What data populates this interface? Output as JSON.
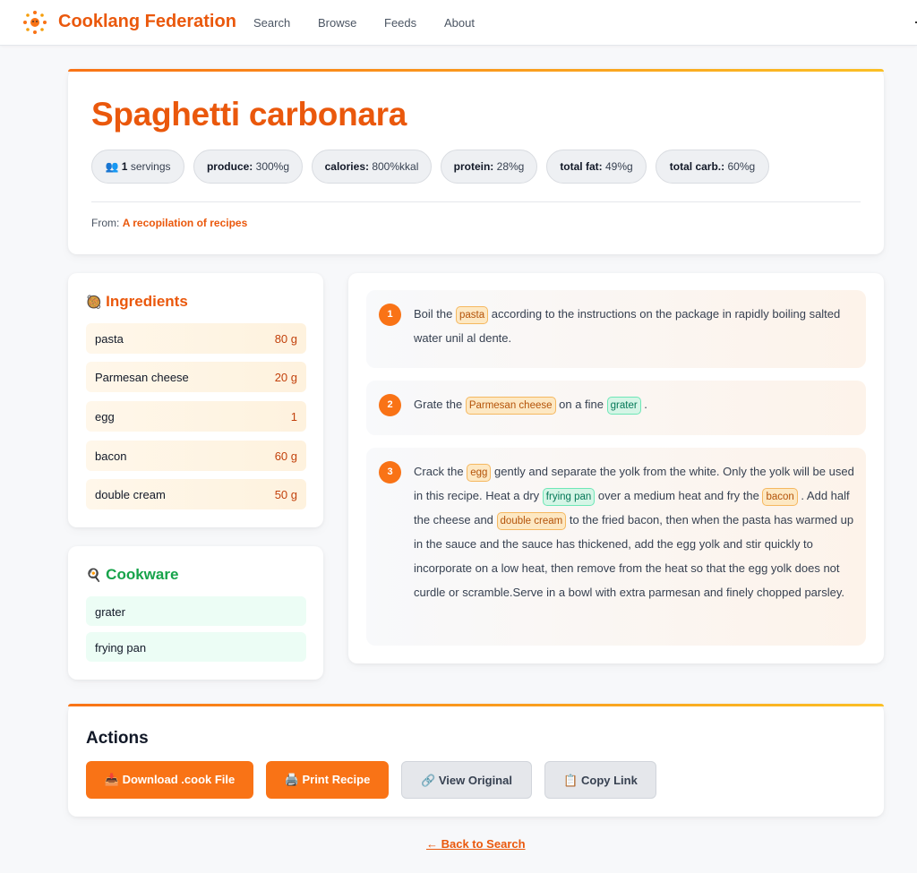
{
  "nav": {
    "brand": "Cooklang Federation",
    "links": [
      "Search",
      "Browse",
      "Feeds",
      "About"
    ]
  },
  "recipe": {
    "title": "Spaghetti carbonara",
    "servings_icon": "👥",
    "servings_count": "1",
    "servings_label": "servings",
    "nutrition": [
      {
        "label": "produce:",
        "value": "300%g"
      },
      {
        "label": "calories:",
        "value": "800%kkal"
      },
      {
        "label": "protein:",
        "value": "28%g"
      },
      {
        "label": "total fat:",
        "value": "49%g"
      },
      {
        "label": "total carb.:",
        "value": "60%g"
      }
    ],
    "from_label": "From:",
    "from_link": "A recopilation of recipes"
  },
  "ingredients": {
    "icon": "🥘",
    "heading": "Ingredients",
    "items": [
      {
        "name": "pasta",
        "qty": "80 g"
      },
      {
        "name": "Parmesan cheese",
        "qty": "20 g"
      },
      {
        "name": "egg",
        "qty": "1"
      },
      {
        "name": "bacon",
        "qty": "60 g"
      },
      {
        "name": "double cream",
        "qty": "50 g"
      }
    ]
  },
  "cookware": {
    "icon": "🍳",
    "heading": "Cookware",
    "items": [
      "grater",
      "frying pan"
    ]
  },
  "steps": [
    {
      "num": "1",
      "parts": [
        {
          "t": "Boil the "
        },
        {
          "ing": "pasta"
        },
        {
          "t": " according to the instructions on the package in rapidly boiling salted water unil al dente."
        }
      ]
    },
    {
      "num": "2",
      "parts": [
        {
          "t": "Grate the "
        },
        {
          "ing": "Parmesan cheese"
        },
        {
          "t": " on a fine "
        },
        {
          "cw": "grater"
        },
        {
          "t": " ."
        }
      ]
    },
    {
      "num": "3",
      "parts": [
        {
          "t": "Crack the "
        },
        {
          "ing": "egg"
        },
        {
          "t": " gently and separate the yolk from the white. Only the yolk will be used in this recipe. Heat a dry "
        },
        {
          "cw": "frying pan"
        },
        {
          "t": " over a medium heat and fry the "
        },
        {
          "ing": "bacon"
        },
        {
          "t": " . Add half the cheese and "
        },
        {
          "ing": "double cream"
        },
        {
          "t": " to the fried bacon, then when the pasta has warmed up in the sauce and the sauce has thickened, add the egg yolk and stir quickly to incorporate on a low heat, then remove from the heat so that the egg yolk does not curdle or scramble.Serve in a bowl with extra parmesan and finely chopped parsley."
        }
      ]
    }
  ],
  "actions": {
    "heading": "Actions",
    "buttons": [
      {
        "icon": "📥",
        "label": "Download .cook File"
      },
      {
        "icon": "🖨️",
        "label": "Print Recipe"
      },
      {
        "icon": "🔗",
        "label": "View Original"
      },
      {
        "icon": "📋",
        "label": "Copy Link"
      }
    ]
  },
  "back_link": "← Back to Search",
  "colors": {
    "accent": "#f97316",
    "brand": "#ea580c",
    "cookware": "#16a34a"
  }
}
